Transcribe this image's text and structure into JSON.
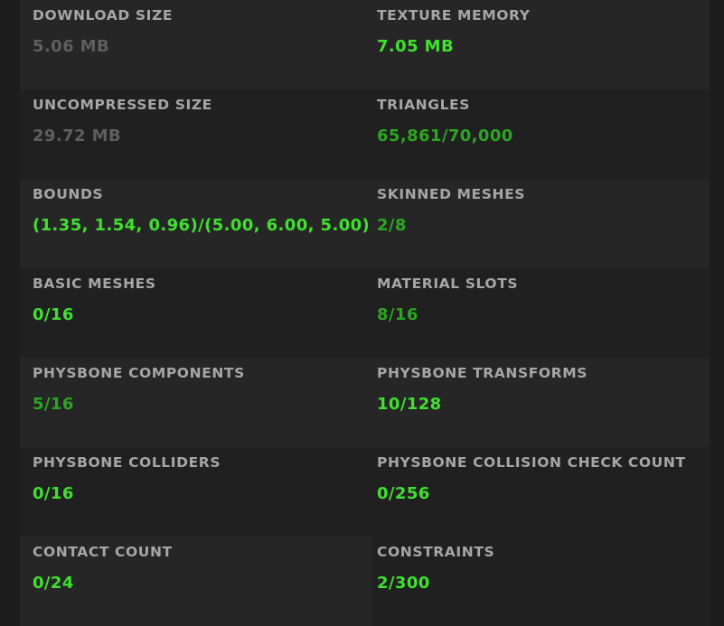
{
  "colors": {
    "background": "#1d1d1d",
    "label": "#a6a6a6",
    "value_gray": "#5f5f5f",
    "value_bright_green": "#3fe12e",
    "value_dim_green": "#2ca622"
  },
  "stats": {
    "download_size": {
      "label": "DOWNLOAD SIZE",
      "value": "5.06 MB"
    },
    "texture_memory": {
      "label": "TEXTURE MEMORY",
      "value": "7.05 MB"
    },
    "uncompressed_size": {
      "label": "UNCOMPRESSED SIZE",
      "value": "29.72 MB"
    },
    "triangles": {
      "label": "TRIANGLES",
      "value": "65,861/70,000"
    },
    "bounds": {
      "label": "BOUNDS",
      "value": "(1.35, 1.54, 0.96)/(5.00, 6.00, 5.00)"
    },
    "skinned_meshes": {
      "label": "SKINNED MESHES",
      "value": "2/8"
    },
    "basic_meshes": {
      "label": "BASIC MESHES",
      "value": "0/16"
    },
    "material_slots": {
      "label": "MATERIAL SLOTS",
      "value": "8/16"
    },
    "physbone_components": {
      "label": "PHYSBONE COMPONENTS",
      "value": "5/16"
    },
    "physbone_transforms": {
      "label": "PHYSBONE TRANSFORMS",
      "value": "10/128"
    },
    "physbone_colliders": {
      "label": "PHYSBONE COLLIDERS",
      "value": "0/16"
    },
    "physbone_collision_check_count": {
      "label": "PHYSBONE COLLISION CHECK COUNT",
      "value": "0/256"
    },
    "contact_count": {
      "label": "CONTACT COUNT",
      "value": "0/24"
    },
    "constraints": {
      "label": "CONSTRAINTS",
      "value": "2/300"
    }
  }
}
